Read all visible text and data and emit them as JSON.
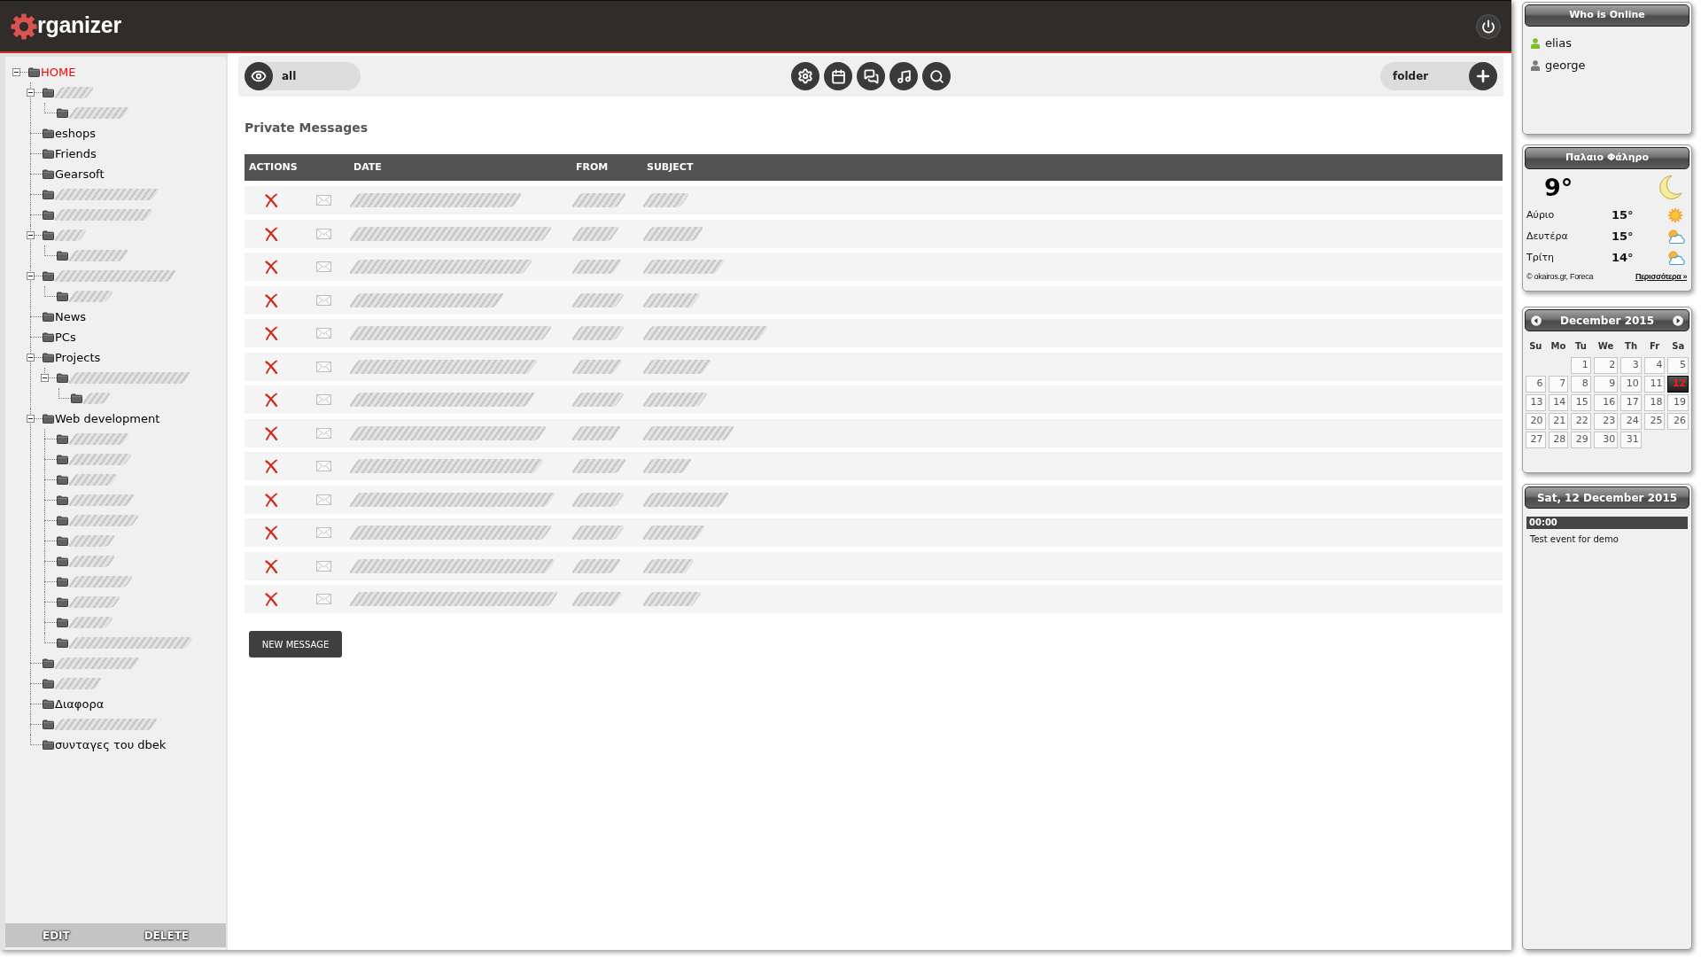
{
  "header": {
    "logo_text": "rganizer"
  },
  "sidebar": {
    "tree": [
      {
        "label": "HOME",
        "selected": true,
        "expanded": true,
        "children": [
          {
            "redacted": true,
            "selected": false,
            "expanded": true,
            "children": [
              {
                "redacted": true,
                "selected": false
              }
            ]
          },
          {
            "label": "eshops",
            "selected": false
          },
          {
            "label": "Friends",
            "selected": false
          },
          {
            "label": "Gearsoft",
            "selected": false
          },
          {
            "redacted": true,
            "selected": false
          },
          {
            "redacted": true,
            "selected": false
          },
          {
            "redacted": true,
            "selected": false,
            "expanded": true,
            "children": [
              {
                "redacted": true,
                "selected": false
              }
            ]
          },
          {
            "redacted": true,
            "selected": false,
            "expanded": true,
            "children": [
              {
                "redacted": true,
                "selected": false
              }
            ]
          },
          {
            "label": "News",
            "selected": false
          },
          {
            "label": "PCs",
            "selected": false
          },
          {
            "label": "Projects",
            "selected": false,
            "expanded": true,
            "children": [
              {
                "redacted": true,
                "selected": false,
                "expanded": true,
                "children": [
                  {
                    "redacted": true,
                    "selected": false
                  }
                ]
              }
            ]
          },
          {
            "label": "Web development",
            "selected": false,
            "expanded": true,
            "children": [
              {
                "redacted": true,
                "selected": false
              },
              {
                "redacted": true,
                "selected": false
              },
              {
                "redacted": true,
                "selected": false
              },
              {
                "redacted": true,
                "selected": false
              },
              {
                "redacted": true,
                "selected": false
              },
              {
                "redacted": true,
                "selected": false
              },
              {
                "redacted": true,
                "selected": false
              },
              {
                "redacted": true,
                "selected": false
              },
              {
                "redacted": true,
                "selected": false
              },
              {
                "redacted": true,
                "selected": false
              },
              {
                "redacted": true,
                "selected": false
              }
            ]
          },
          {
            "redacted": true,
            "selected": false
          },
          {
            "redacted": true,
            "selected": false
          },
          {
            "label": "Διαφορα",
            "selected": false
          },
          {
            "redacted": true,
            "selected": false
          },
          {
            "label": "συνταγες του dbek",
            "selected": false
          }
        ]
      }
    ],
    "actions": [
      "EDIT",
      "DELETE"
    ]
  },
  "toolbar": {
    "filter_label": "all",
    "folder_label": "folder"
  },
  "messages": {
    "title": "Private Messages",
    "columns": [
      "ACTIONS",
      "DATE",
      "FROM",
      "SUBJECT"
    ],
    "rows": [
      {
        "redacted": true
      },
      {
        "redacted": true
      },
      {
        "redacted": true
      },
      {
        "redacted": true
      },
      {
        "redacted": true
      },
      {
        "redacted": true
      },
      {
        "redacted": true
      },
      {
        "redacted": true
      },
      {
        "redacted": true
      },
      {
        "redacted": true
      },
      {
        "redacted": true
      },
      {
        "redacted": true
      },
      {
        "redacted": true
      }
    ],
    "new_button": "NEW MESSAGE"
  },
  "who_is_online": {
    "title": "Who is Online",
    "users": [
      {
        "name": "elias",
        "online": true
      },
      {
        "name": "george",
        "online": false
      }
    ]
  },
  "weather": {
    "title": "Παλαιο Φάληρο",
    "current": {
      "temperature": "9°",
      "kind": "clear_night"
    },
    "forecast": [
      {
        "day": "Αύριο",
        "temperature": "15°",
        "kind": "sunny"
      },
      {
        "day": "Δευτέρα",
        "temperature": "15°",
        "kind": "partly_cloudy"
      },
      {
        "day": "Τρίτη",
        "temperature": "14°",
        "kind": "partly_cloudy"
      }
    ],
    "credit": "© okairos.gr, Foreca",
    "more_link": "Περισσότερα »"
  },
  "calendar": {
    "title": "December 2015",
    "weekdays": [
      "Su",
      "Mo",
      "Tu",
      "We",
      "Th",
      "Fr",
      "Sa"
    ],
    "weeks": [
      [
        {
          "day": "1",
          "selected": false
        },
        {
          "day": "2",
          "selected": false
        },
        {
          "day": "3",
          "selected": false
        },
        {
          "day": "4",
          "selected": false
        },
        {
          "day": "5",
          "selected": false
        }
      ],
      [
        {
          "day": "6",
          "selected": false
        },
        {
          "day": "7",
          "selected": false
        },
        {
          "day": "8",
          "selected": false
        },
        {
          "day": "9",
          "selected": false
        },
        {
          "day": "10",
          "selected": false
        },
        {
          "day": "11",
          "selected": false
        },
        {
          "day": "12",
          "selected": true
        }
      ],
      [
        {
          "day": "13",
          "selected": false
        },
        {
          "day": "14",
          "selected": false
        },
        {
          "day": "15",
          "selected": false
        },
        {
          "day": "16",
          "selected": false
        },
        {
          "day": "17",
          "selected": false
        },
        {
          "day": "18",
          "selected": false
        },
        {
          "day": "19",
          "selected": false
        }
      ],
      [
        {
          "day": "20",
          "selected": false
        },
        {
          "day": "21",
          "selected": false
        },
        {
          "day": "22",
          "selected": false
        },
        {
          "day": "23",
          "selected": false
        },
        {
          "day": "24",
          "selected": false
        },
        {
          "day": "25",
          "selected": false
        },
        {
          "day": "26",
          "selected": false
        }
      ],
      [
        {
          "day": "27",
          "selected": false
        },
        {
          "day": "28",
          "selected": false
        },
        {
          "day": "29",
          "selected": false
        },
        {
          "day": "30",
          "selected": false
        },
        {
          "day": "31",
          "selected": false
        }
      ]
    ]
  },
  "day_events": {
    "title": "Sat, 12 December 2015",
    "events": [
      {
        "time": "00:00",
        "title": "Test event for demo"
      }
    ]
  }
}
